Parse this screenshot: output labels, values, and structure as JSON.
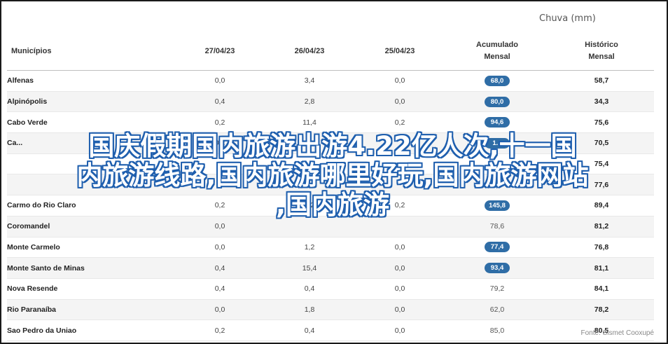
{
  "unit_label": "Chuva (mm)",
  "columns": [
    "Municípios",
    "27/04/23",
    "26/04/23",
    "25/04/23",
    "Acumulado Mensal",
    "Histórico Mensal"
  ],
  "columns_lines": [
    [
      "Municípios"
    ],
    [
      "27/04/23"
    ],
    [
      "26/04/23"
    ],
    [
      "25/04/23"
    ],
    [
      "Acumulado",
      "Mensal"
    ],
    [
      "Histórico",
      "Mensal"
    ]
  ],
  "rows": [
    {
      "name": "Alfenas",
      "d27": "0,0",
      "d26": "3,4",
      "d25": "0,0",
      "acum": "68,0",
      "acum_highlight": true,
      "hist": "58,7"
    },
    {
      "name": "Alpinópolis",
      "d27": "0,4",
      "d26": "2,8",
      "d25": "0,0",
      "acum": "80,0",
      "acum_highlight": true,
      "hist": "34,3"
    },
    {
      "name": "Cabo Verde",
      "d27": "0,2",
      "d26": "11,4",
      "d25": "0,2",
      "acum": "94,6",
      "acum_highlight": true,
      "hist": "75,6"
    },
    {
      "name": "Ca...",
      "d27": "0,2",
      "d26": "",
      "d25": "",
      "acum": "1...",
      "acum_highlight": true,
      "hist": "70,5"
    },
    {
      "name": "",
      "d27": "",
      "d26": "",
      "d25": "",
      "acum": "",
      "acum_highlight": false,
      "hist": "75,4"
    },
    {
      "name": "",
      "d27": "",
      "d26": "",
      "d25": "",
      "acum": "",
      "acum_highlight": false,
      "hist": "77,6"
    },
    {
      "name": "Carmo do Rio Claro",
      "d27": "0,2",
      "d26": "0,2",
      "d25": "0,2",
      "acum": "145,8",
      "acum_highlight": true,
      "hist": "89,4"
    },
    {
      "name": "Coromandel",
      "d27": "0,0",
      "d26": "",
      "d25": "",
      "acum": "78,6",
      "acum_highlight": false,
      "hist": "81,2"
    },
    {
      "name": "Monte Carmelo",
      "d27": "0,0",
      "d26": "1,2",
      "d25": "0,0",
      "acum": "77,4",
      "acum_highlight": true,
      "hist": "76,8"
    },
    {
      "name": "Monte Santo de Minas",
      "d27": "0,4",
      "d26": "15,4",
      "d25": "0,0",
      "acum": "93,4",
      "acum_highlight": true,
      "hist": "81,1"
    },
    {
      "name": "Nova Resende",
      "d27": "0,4",
      "d26": "0,4",
      "d25": "0,0",
      "acum": "79,2",
      "acum_highlight": false,
      "hist": "84,1"
    },
    {
      "name": "Rio Paranaíba",
      "d27": "0,0",
      "d26": "1,8",
      "d25": "0,0",
      "acum": "62,0",
      "acum_highlight": false,
      "hist": "78,2"
    },
    {
      "name": "Sao Pedro da Uniao",
      "d27": "0,2",
      "d26": "0,4",
      "d25": "0,0",
      "acum": "85,0",
      "acum_highlight": false,
      "hist": "80,5"
    }
  ],
  "source": "Fonte: Sismet Cooxupé",
  "overlay_lines": [
    "国庆假期国内旅游出游4.22亿人次,十一国",
    "内旅游线路,国内旅游哪里好玩,国内旅游网站",
    ",国内旅游"
  ],
  "colors": {
    "pill": "#2f6da6",
    "overlay_stroke": "#1f5fae"
  }
}
